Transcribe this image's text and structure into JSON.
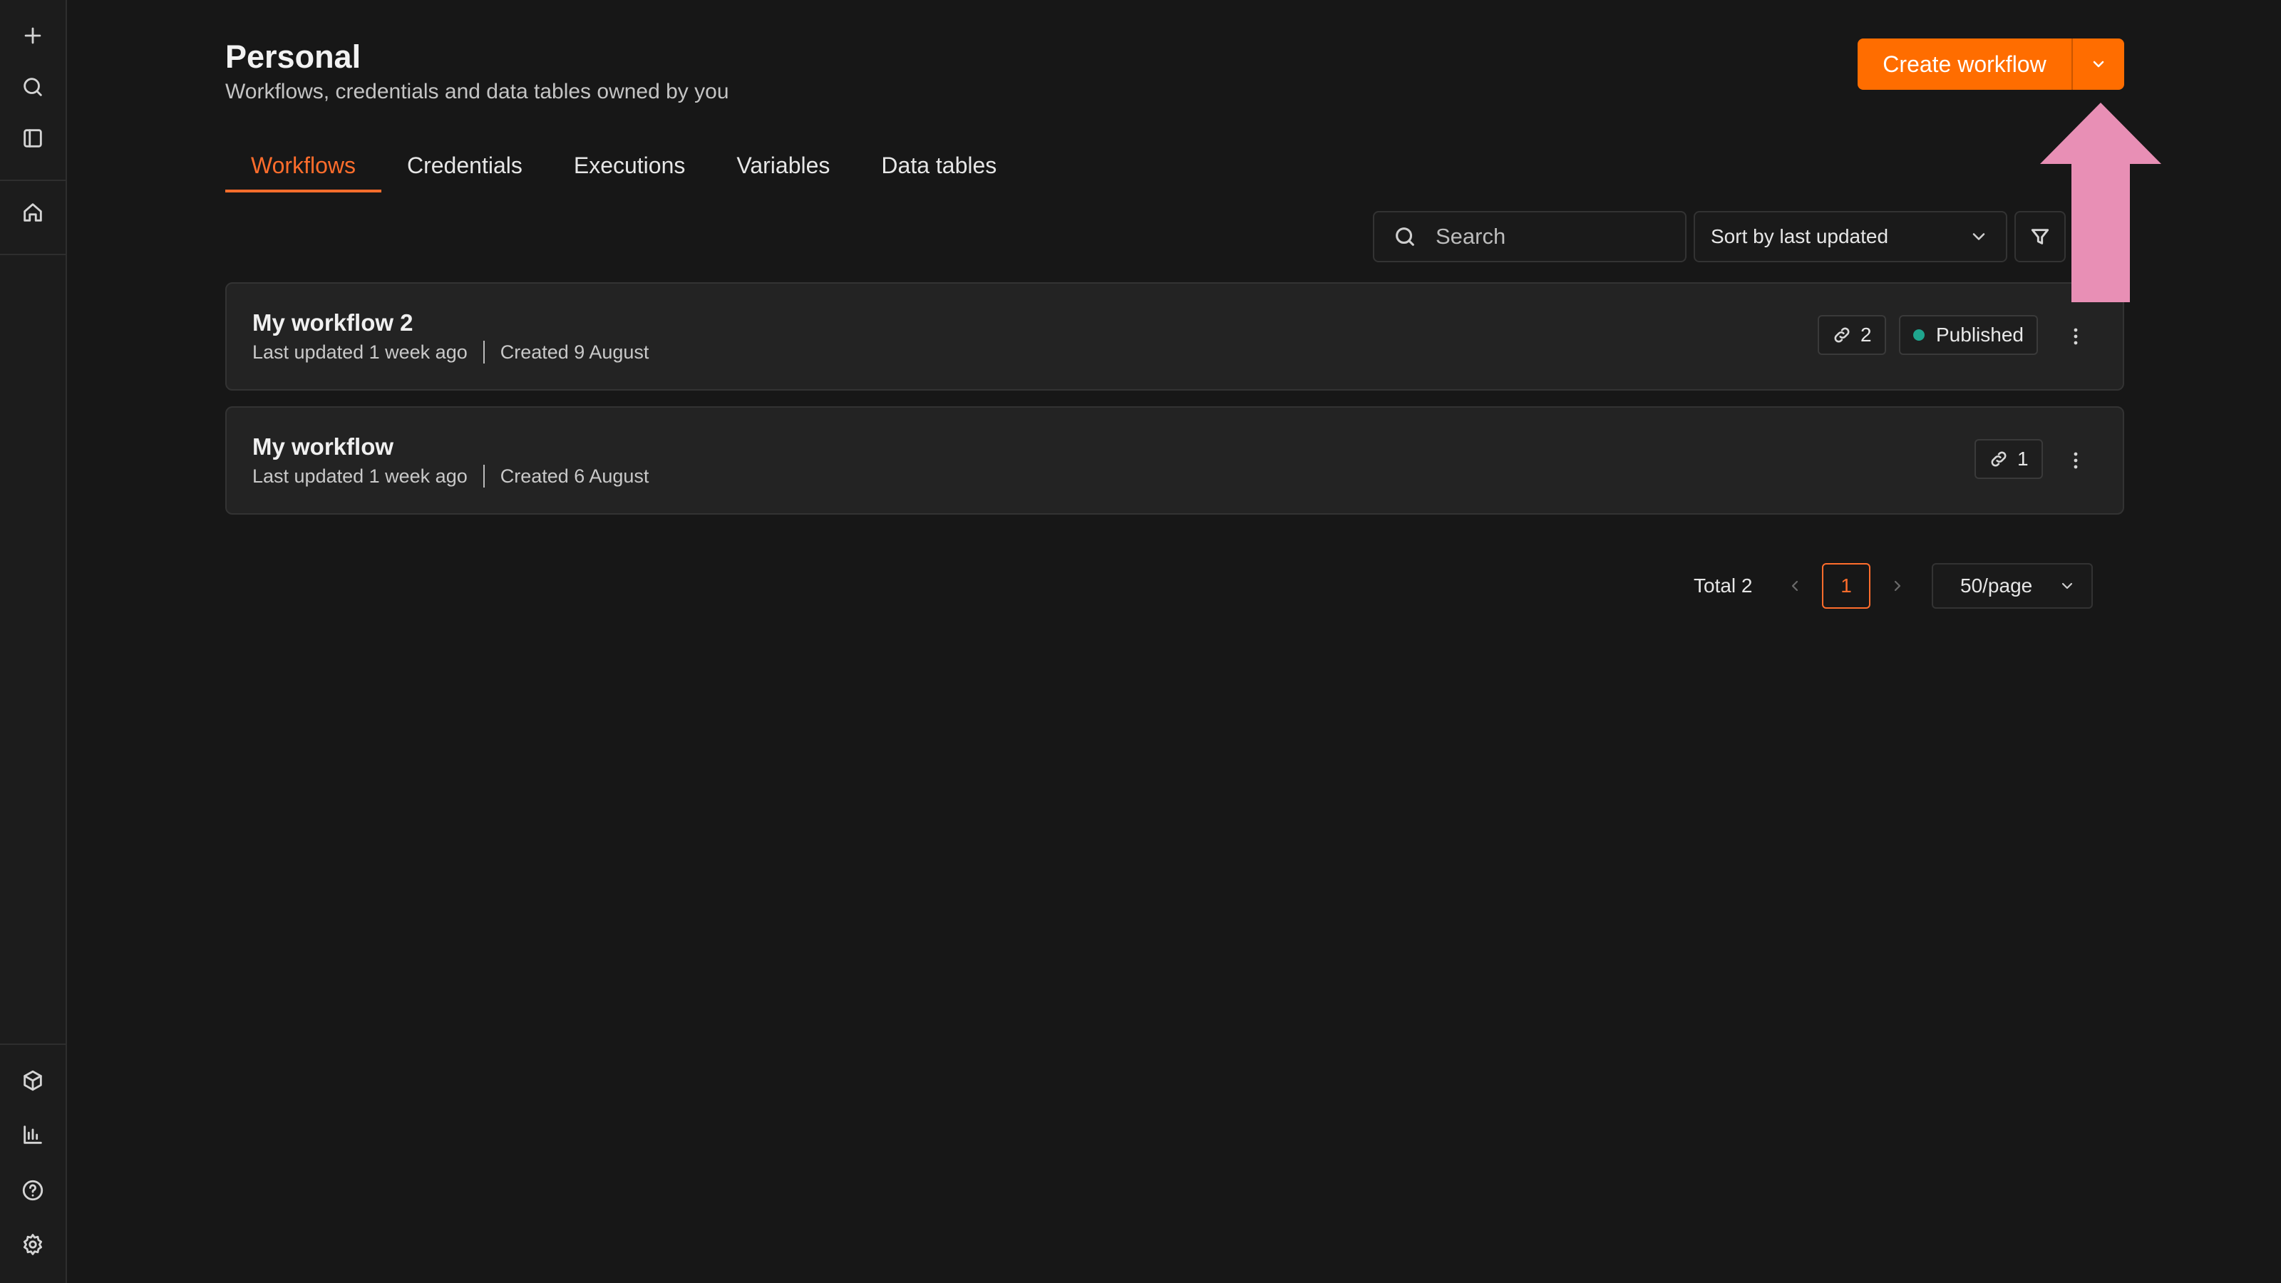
{
  "sidebar": {
    "top_icons": [
      "plus-icon",
      "search-icon",
      "sidebar-toggle-icon",
      "home-icon"
    ],
    "bottom_icons": [
      "cube-icon",
      "chart-icon",
      "help-icon",
      "settings-icon"
    ]
  },
  "header": {
    "title": "Personal",
    "subtitle": "Workflows, credentials and data tables owned by you",
    "create_label": "Create workflow"
  },
  "tabs": [
    {
      "label": "Workflows",
      "active": true
    },
    {
      "label": "Credentials",
      "active": false
    },
    {
      "label": "Executions",
      "active": false
    },
    {
      "label": "Variables",
      "active": false
    },
    {
      "label": "Data tables",
      "active": false
    }
  ],
  "toolbar": {
    "search_placeholder": "Search",
    "sort_label": "Sort by last updated"
  },
  "workflows": [
    {
      "name": "My workflow 2",
      "updated": "Last updated 1 week ago",
      "created": "Created 9 August",
      "links": "2",
      "status": "Published"
    },
    {
      "name": "My workflow",
      "updated": "Last updated 1 week ago",
      "created": "Created 6 August",
      "links": "1",
      "status": ""
    }
  ],
  "pagination": {
    "total": "Total 2",
    "current_page": "1",
    "per_page": "50/page"
  },
  "colors": {
    "accent": "#ff6d00",
    "tab_active": "#ff6d2c",
    "published_dot": "#1fa58e",
    "annotation_arrow": "#e88fb5"
  }
}
